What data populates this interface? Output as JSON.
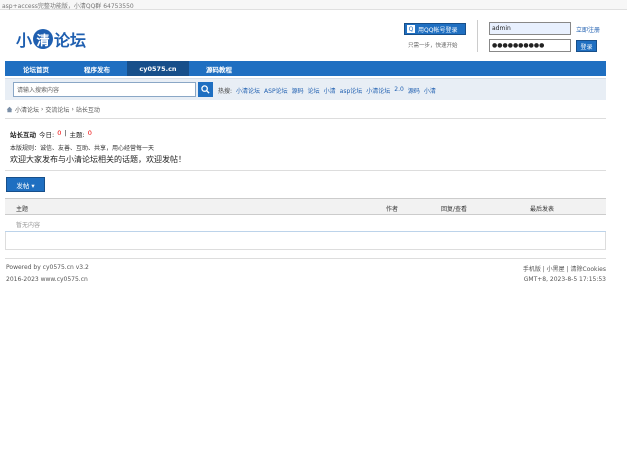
{
  "topbar": {
    "text": "asp+access完整功能版，小清QQ群 64753550"
  },
  "logo": {
    "part1": "小",
    "part2": "清",
    "part3": "论坛"
  },
  "qq_login": {
    "label": "用QQ帐号登录",
    "tip": "只需一步，快速开始"
  },
  "login": {
    "username": "admin",
    "password": "●●●●●●●●●●",
    "register_label": "立即注册",
    "login_label": "登录"
  },
  "nav": {
    "items": [
      {
        "label": "论坛首页",
        "active": false
      },
      {
        "label": "程序发布",
        "active": false
      },
      {
        "label": "cy0575.cn",
        "active": true
      },
      {
        "label": "源码教程",
        "active": false
      }
    ]
  },
  "search": {
    "placeholder": "请输入搜索内容",
    "hot_label": "热搜:",
    "hot_tags": [
      "小清论坛",
      "ASP论坛",
      "源码",
      "论坛",
      "小清",
      "asp论坛",
      "小清论坛",
      "2.0",
      "源码",
      "小清"
    ]
  },
  "breadcrumb": {
    "items": [
      "小清论坛",
      "›",
      "交流论坛",
      "›",
      "站长互动"
    ]
  },
  "forum": {
    "name": "站长互动",
    "today_label": "今日:",
    "today_value": "0",
    "sep": "|",
    "topics_label": "主题:",
    "topics_value": "0",
    "rules_line1": "本版规则：诚信、友善、互助、共享，用心经营每一天",
    "rules_line2": "欢迎大家发布与小清论坛相关的话题，欢迎发帖！"
  },
  "post_button": {
    "label": "发帖 ▾"
  },
  "table": {
    "headers": {
      "title": "主题",
      "author": "作者",
      "replies": "回复/查看",
      "last": "最后发表"
    },
    "empty_text": "暂无内容"
  },
  "footer": {
    "powered": "Powered by cy0575.cn v3.2",
    "copyright": "2016-2023 www.cy0575.cn",
    "links": "手机版 | 小黑屋 | 清除Cookies",
    "time": "GMT+8, 2023-8-5 17:15:53"
  },
  "colors": {
    "primary": "#1f6fc1",
    "primary_dark": "#174f8a",
    "accent_red": "#ee0000"
  }
}
